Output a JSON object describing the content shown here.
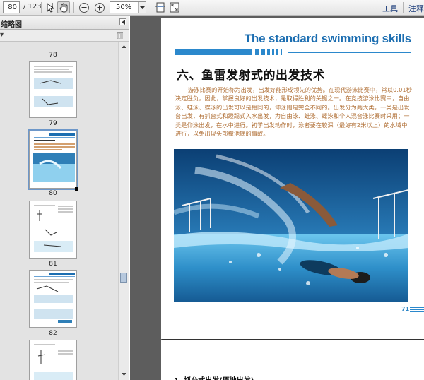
{
  "toolbar": {
    "current_page": "80",
    "total_pages": "/ 123",
    "zoom": "50%",
    "tools_label": "工具",
    "comment_label": "注释",
    "icons": [
      "select-text-icon",
      "hand-icon",
      "zoom-out-icon",
      "zoom-in-icon",
      "zoom-dropdown-icon",
      "fit-width-icon",
      "fit-page-icon"
    ]
  },
  "sidebar": {
    "title": "缩略图",
    "options_glyph": "▾",
    "thumbnails": [
      {
        "label": "78"
      },
      {
        "label": "79"
      },
      {
        "label": "80"
      },
      {
        "label": "81"
      },
      {
        "label": "82"
      }
    ]
  },
  "page": {
    "banner": "The standard swimming skills",
    "heading": "六、鱼雷发射式的出发技术",
    "body": "游泳比赛的开始称为出发，出发好能形成领先的优势。在现代游泳比赛中，常以0.01秒决定胜负，因此，掌握良好的出发技术，是取得胜利的关键之一。在竞技游泳比赛中，自由泳、蛙泳、蝶泳的出发可以是相同的，仰泳则是完全不同的。出发分为两大类，一类是出发台出发，有抓台式和蹬踢式入水出发，为自由泳、蛙泳、蝶泳和个人混合泳比赛时采用；一类是仰泳出发，在水中进行。初学出发动作时，泳者要在较深（最好有2米以上）的水域中进行，以免出现头部撞池底的事故。",
    "page_number": "71"
  },
  "next_page": {
    "heading": "1. 抓台式出发(原地出发)"
  },
  "colors": {
    "accent_blue": "#1c6eb1",
    "body_text": "#b06f35",
    "doc_background": "#5d5d5d",
    "panel_background": "#e3e3e3"
  }
}
